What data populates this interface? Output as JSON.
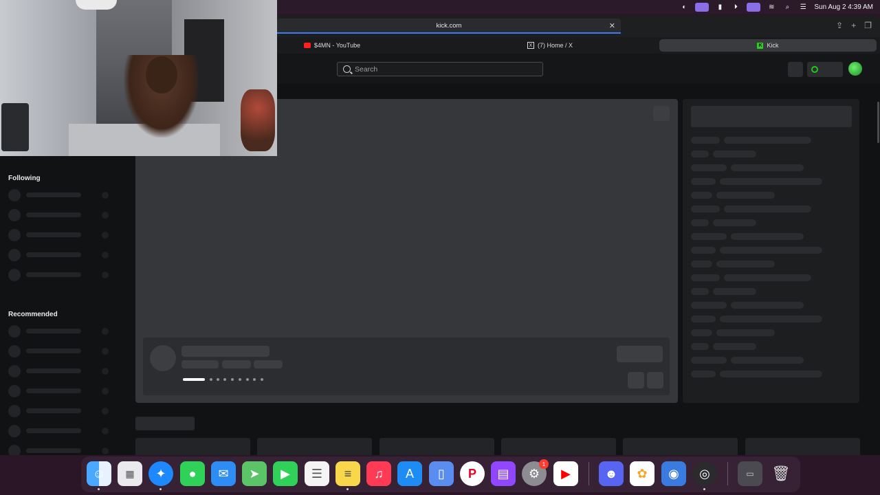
{
  "menubar": {
    "clock": "Sun Aug 2  4:39 AM",
    "icons": [
      "copilot-icon",
      "screen-record-icon",
      "battery-icon",
      "play-icon",
      "control-center-icon",
      "wifi-icon",
      "spotlight-icon",
      "settings-icon"
    ]
  },
  "browser": {
    "address": "kick.com",
    "tabs": [
      {
        "label": "$4MN - YouTube",
        "favicon": "youtube-icon"
      },
      {
        "label": "(7) Home / X",
        "favicon": "x-icon"
      },
      {
        "label": "Kick",
        "favicon": "kick-icon"
      }
    ]
  },
  "page": {
    "search_placeholder": "Search",
    "sidebar": {
      "following_label": "Following",
      "recommended_label": "Recommended"
    }
  },
  "colors": {
    "accent_green": "#28d21e",
    "address_underline": "#3b7bf5",
    "badge_red": "#ff3b30"
  },
  "dock": {
    "apps": [
      "finder-icon",
      "launchpad-icon",
      "safari-icon",
      "messages-icon",
      "mail-icon",
      "maps-icon",
      "facetime-icon",
      "reminders-icon",
      "notes-icon",
      "music-icon",
      "app-store-icon",
      "iphone-mirroring-icon",
      "pinterest-icon",
      "twitch-icon",
      "system-settings-icon",
      "youtube-icon",
      "discord-icon",
      "photos-icon",
      "vpn-icon",
      "obs-icon",
      "downloads-stack-icon",
      "trash-icon"
    ],
    "settings_badge": "1"
  }
}
